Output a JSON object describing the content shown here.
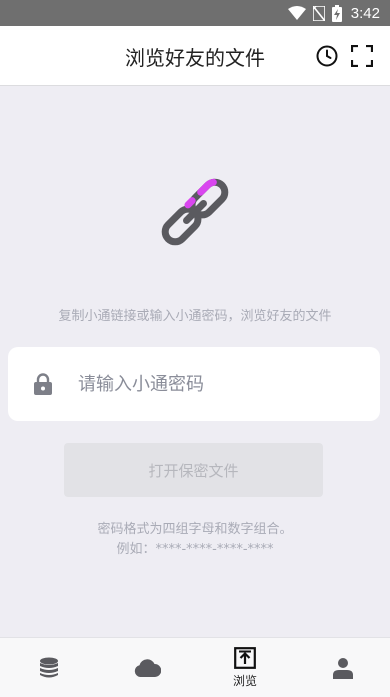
{
  "status_bar": {
    "time": "3:42",
    "icons": [
      "wifi-icon",
      "no-sim-icon",
      "battery-icon"
    ]
  },
  "header": {
    "title": "浏览好友的文件",
    "actions": [
      "history-icon",
      "fullscreen-icon"
    ]
  },
  "main": {
    "icon": "link-icon",
    "hint": "复制小通链接或输入小通密码，浏览好友的文件",
    "password_input": {
      "placeholder": "请输入小通密码",
      "value": ""
    },
    "open_button_label": "打开保密文件",
    "format_note_line1": "密码格式为四组字母和数字组合。",
    "format_note_line2": "例如：****-****-****-****"
  },
  "bottom_nav": {
    "items": [
      {
        "icon": "database-icon",
        "label": ""
      },
      {
        "icon": "cloud-icon",
        "label": ""
      },
      {
        "icon": "browse-upload-icon",
        "label": "浏览",
        "active": true
      },
      {
        "icon": "person-icon",
        "label": ""
      }
    ]
  },
  "colors": {
    "accent": "#d946ef",
    "icon_gray": "#5a5a5f",
    "background": "#eeedf3"
  }
}
